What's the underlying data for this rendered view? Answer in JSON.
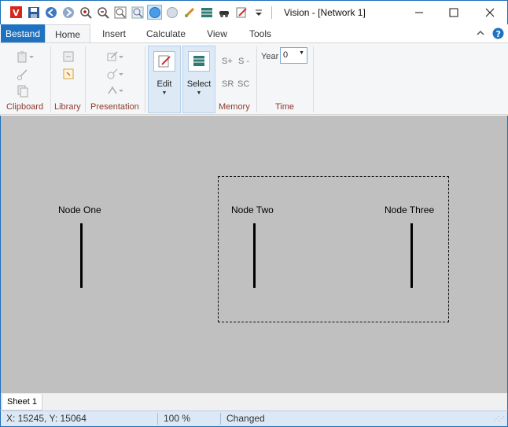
{
  "window": {
    "title": "Vision - [Network 1]",
    "controls": [
      "minimize-icon",
      "maximize-icon",
      "close-icon"
    ]
  },
  "quick_access": [
    "app-logo-icon",
    "save-icon",
    "back-icon",
    "forward-icon",
    "zoom-in-icon",
    "zoom-out-icon",
    "zoom-extent-icon",
    "zoom-window-icon",
    "select-node-icon",
    "node-icon",
    "link-icon",
    "table-icon",
    "car-icon",
    "edit-icon",
    "customize-icon"
  ],
  "tabs": {
    "file": "Bestand",
    "items": [
      "Home",
      "Insert",
      "Calculate",
      "View",
      "Tools"
    ],
    "selected": "Home"
  },
  "ribbon": {
    "groups": {
      "clipboard": "Clipboard",
      "library": "Library",
      "presentation": "Presentation",
      "memory": "Memory",
      "time": "Time"
    },
    "edit_label": "Edit",
    "select_label": "Select",
    "memory": {
      "s_plus": "S+",
      "s_minus": "S -",
      "sr": "SR",
      "sc": "SC"
    },
    "year_label": "Year",
    "year_value": "0"
  },
  "canvas": {
    "nodes": [
      {
        "label": "Node One"
      },
      {
        "label": "Node Two"
      },
      {
        "label": "Node Three"
      }
    ]
  },
  "sheets": [
    "Sheet 1"
  ],
  "status": {
    "coords": "X: 15245, Y: 15064",
    "zoom": "100 %",
    "state": "Changed"
  },
  "colors": {
    "accent": "#1f72c1",
    "canvas": "#c0c0c0",
    "group_label": "#8c3b2e"
  }
}
